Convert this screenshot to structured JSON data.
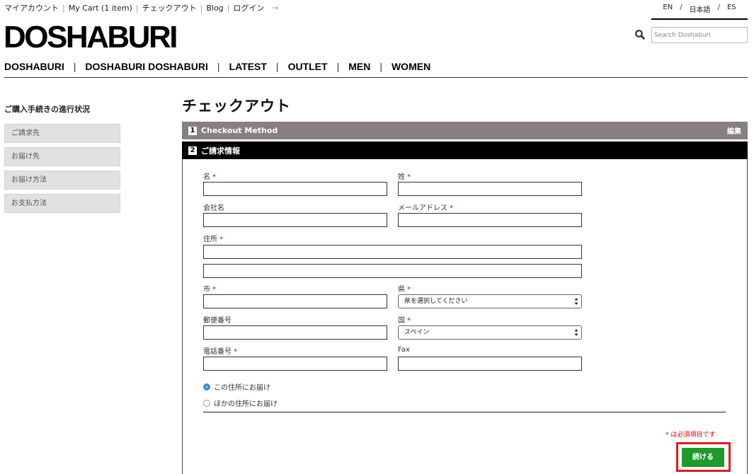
{
  "top_links": [
    "マイアカウント",
    "My Cart (1 item)",
    "チェックアウト",
    "Blog",
    "ログイン"
  ],
  "languages": [
    "EN",
    "日本語",
    "ES"
  ],
  "logo": "DOSHABURI",
  "search": {
    "placeholder": "Search Doshaburi"
  },
  "main_nav": [
    "DOSHABURI",
    "DOSHABURI DOSHABURI",
    "LATEST",
    "OUTLET",
    "MEN",
    "WOMEN"
  ],
  "sidebar": {
    "title": "ご購入手続きの進行状況",
    "items": [
      "ご請求先",
      "お届け先",
      "お届け方法",
      "お支払方法"
    ]
  },
  "page_title": "チェックアウト",
  "steps": [
    {
      "num": "1",
      "label": "Checkout Method",
      "action": "編集"
    },
    {
      "num": "2",
      "label": "ご請求情報"
    }
  ],
  "form": {
    "first_name": {
      "label": "名",
      "value": ""
    },
    "last_name": {
      "label": "姓",
      "value": ""
    },
    "company": {
      "label": "会社名",
      "value": ""
    },
    "email": {
      "label": "メールアドレス",
      "value": ""
    },
    "address": {
      "label": "住所",
      "line1": "",
      "line2": ""
    },
    "city": {
      "label": "市",
      "value": ""
    },
    "state": {
      "label": "県",
      "selected": "県を選択してください"
    },
    "postcode": {
      "label": "郵便番号",
      "value": ""
    },
    "country": {
      "label": "国",
      "selected": "スペイン"
    },
    "phone": {
      "label": "電話番号",
      "value": ""
    },
    "fax": {
      "label": "Fax",
      "value": ""
    },
    "required_mark": "*"
  },
  "ship_options": [
    "この住所にお届け",
    "ほかの住所にお届け"
  ],
  "required_note": "* は必須項目です",
  "continue_button": "続ける",
  "colors": {
    "step1_bg": "#877f80",
    "step2_bg": "#000000",
    "button": "#1f9a2b",
    "highlight": "#e21b1b",
    "required": "#dd0000"
  }
}
